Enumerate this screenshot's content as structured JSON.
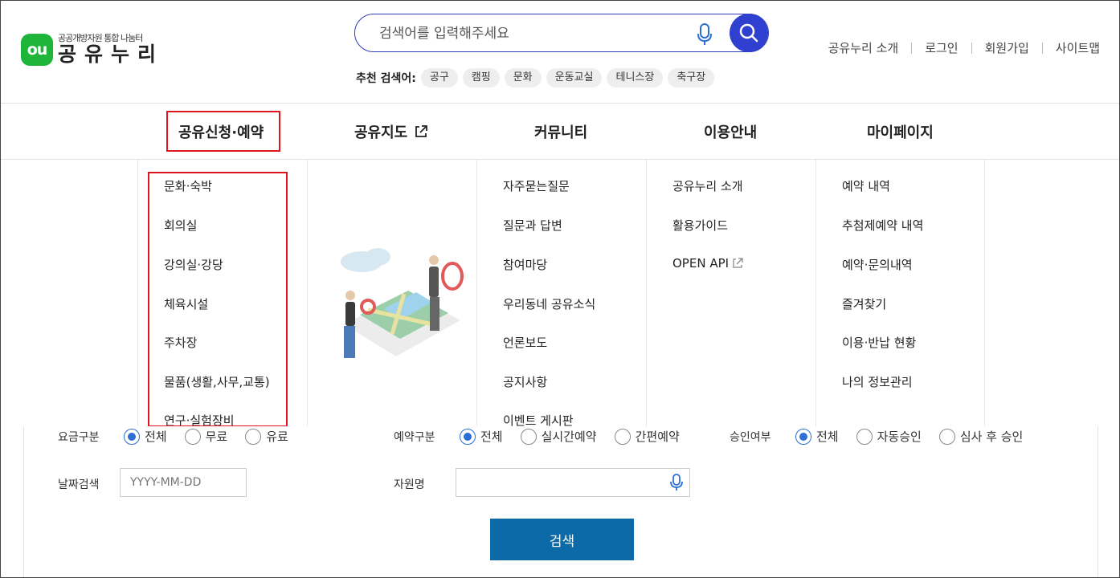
{
  "logo": {
    "mark": "ou",
    "subtitle": "공공개방자원 통합 나눔터",
    "name": "공유누리"
  },
  "search": {
    "placeholder": "검색어를 입력해주세요"
  },
  "recommend": {
    "label": "추천 검색어:",
    "tags": [
      "공구",
      "캠핑",
      "문화",
      "운동교실",
      "테니스장",
      "축구장"
    ]
  },
  "util_links": [
    "공유누리 소개",
    "로그인",
    "회원가입",
    "사이트맵"
  ],
  "gnb": {
    "items": [
      "공유신청·예약",
      "공유지도",
      "커뮤니티",
      "이용안내",
      "마이페이지"
    ]
  },
  "mega": {
    "reservation": [
      "문화·숙박",
      "회의실",
      "강의실·강당",
      "체육시설",
      "주차장",
      "물품(생활,사무,교통)",
      "연구·실험장비"
    ],
    "community": [
      "자주묻는질문",
      "질문과 답변",
      "참여마당",
      "우리동네 공유소식",
      "언론보도",
      "공지사항",
      "이벤트 게시판"
    ],
    "guide": [
      "공유누리 소개",
      "활용가이드",
      "OPEN API"
    ],
    "mypage": [
      "예약 내역",
      "추첨제예약 내역",
      "예약·문의내역",
      "즐겨찾기",
      "이용·반납 현황",
      "나의 정보관리"
    ]
  },
  "form": {
    "fee": {
      "label": "요금구분",
      "options": [
        "전체",
        "무료",
        "유료"
      ],
      "selected": "전체"
    },
    "booking": {
      "label": "예약구분",
      "options": [
        "전체",
        "실시간예약",
        "간편예약"
      ],
      "selected": "전체"
    },
    "approval": {
      "label": "승인여부",
      "options": [
        "전체",
        "자동승인",
        "심사 후 승인"
      ],
      "selected": "전체"
    },
    "date": {
      "label": "날짜검색",
      "placeholder": "YYYY-MM-DD"
    },
    "resource": {
      "label": "자원명"
    },
    "submit": "검색"
  },
  "colors": {
    "brand_green": "#1fb53b",
    "search_blue": "#2f3fcf",
    "highlight_red": "#e0161f",
    "submit_blue": "#0d6aa8",
    "radio_blue": "#2b6fd6"
  }
}
